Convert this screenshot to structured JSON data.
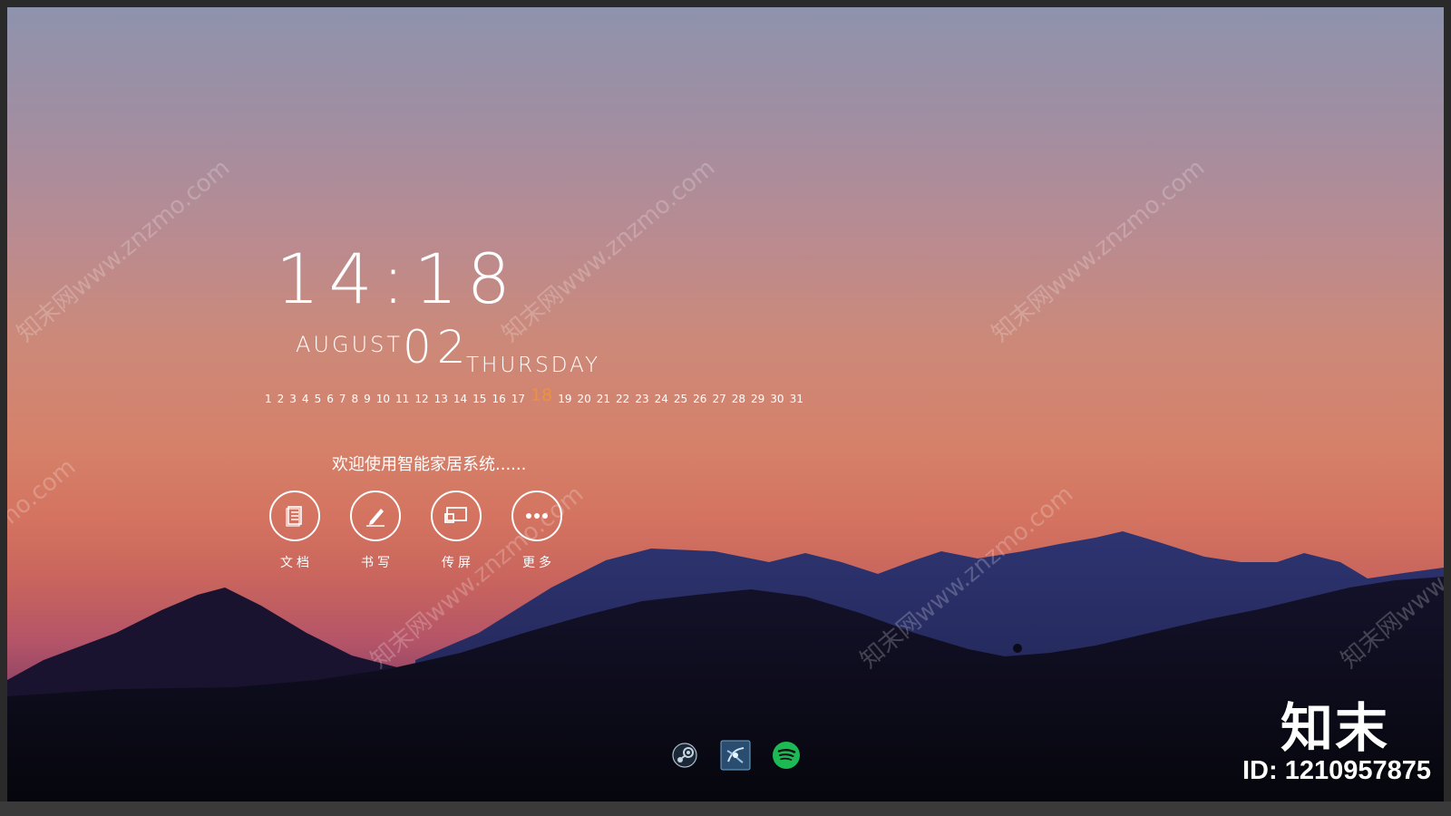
{
  "clock": {
    "time": "14:18",
    "month": "AUGUST",
    "day": "02",
    "weekday": "THURSDAY"
  },
  "day_strip": {
    "days": [
      "1",
      "2",
      "3",
      "4",
      "5",
      "6",
      "7",
      "8",
      "9",
      "10",
      "11",
      "12",
      "13",
      "14",
      "15",
      "16",
      "17",
      "18",
      "19",
      "20",
      "21",
      "22",
      "23",
      "24",
      "25",
      "26",
      "27",
      "28",
      "29",
      "30",
      "31"
    ],
    "current": "18"
  },
  "welcome_text": "欢迎使用智能家居系统......",
  "apps": [
    {
      "label": "文档",
      "icon": "document-icon"
    },
    {
      "label": "书写",
      "icon": "pen-icon"
    },
    {
      "label": "传屏",
      "icon": "cast-screen-icon"
    },
    {
      "label": "更多",
      "icon": "more-icon"
    }
  ],
  "dock": [
    {
      "icon": "steam-icon"
    },
    {
      "icon": "launcher-icon"
    },
    {
      "icon": "spotify-icon"
    }
  ],
  "watermark": {
    "brand": "知末",
    "id": "ID: 1210957875",
    "diagonal_text": "知末网www.znzmo.com"
  },
  "colors": {
    "highlight": "#f0903a",
    "spotify": "#1db954"
  }
}
